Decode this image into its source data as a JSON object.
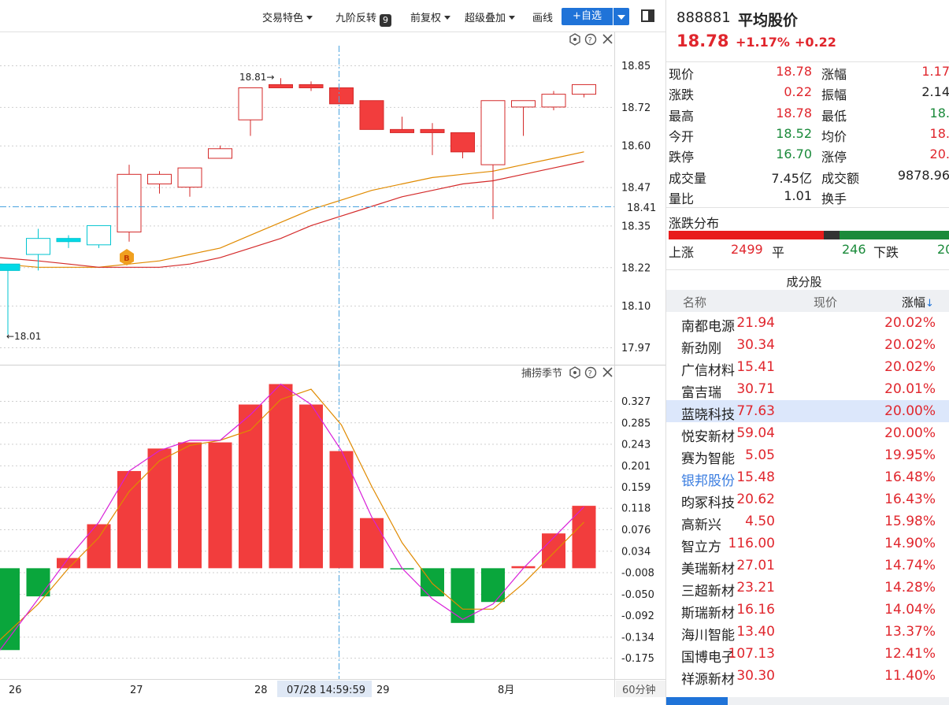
{
  "toolbar": {
    "trade_features": "交易特色",
    "nine_reversal": "九阶反转",
    "nine_badge": "9",
    "adjust": "前复权",
    "overlay": "超级叠加",
    "draw": "画线",
    "add_fav": "+自选"
  },
  "colors": {
    "up": "#e0262d",
    "down": "#1a8a3a",
    "accent": "#1f73d8",
    "up_candle": "#f23d3d",
    "down_candle_cyan": "#00d9e6",
    "macd_down": "#0aa63c"
  },
  "main_chart": {
    "y_ticks": [
      "18.85",
      "18.72",
      "18.60",
      "18.47",
      "18.35",
      "18.22",
      "18.10",
      "17.97"
    ],
    "crosshair_price": "18.41",
    "high_label": "18.81→",
    "low_label": "←18.01",
    "buy_marker": "B"
  },
  "sub_chart": {
    "indicator_name": "捕捞季节",
    "y_ticks": [
      "0.327",
      "0.285",
      "0.243",
      "0.201",
      "0.159",
      "0.118",
      "0.076",
      "0.034",
      "-0.008",
      "-0.050",
      "-0.092",
      "-0.134",
      "-0.175"
    ]
  },
  "x_axis": {
    "labels": [
      "26",
      "27",
      "28",
      "29",
      "8月"
    ],
    "crosshair_time": "07/28 14:59:59",
    "period": "60分钟"
  },
  "chart_data": [
    {
      "type": "candlestick",
      "title": "",
      "x": [
        "7/26-1",
        "7/26-2",
        "7/26-3",
        "7/26-4",
        "7/27-1",
        "7/27-2",
        "7/27-3",
        "7/27-4",
        "7/28-1",
        "7/28-2",
        "7/28-3",
        "7/28-4",
        "7/29-1",
        "7/29-2",
        "7/29-3",
        "7/29-4",
        "8/1-1",
        "8/1-2",
        "8/1-3",
        "8/1-4"
      ],
      "candles": [
        {
          "open": 18.23,
          "close": 18.21,
          "high": 18.23,
          "low": 18.01,
          "dir": "down"
        },
        {
          "open": 18.26,
          "close": 18.31,
          "high": 18.34,
          "low": 18.21,
          "dir": "down"
        },
        {
          "open": 18.31,
          "close": 18.3,
          "high": 18.32,
          "low": 18.28,
          "dir": "down"
        },
        {
          "open": 18.29,
          "close": 18.35,
          "high": 18.35,
          "low": 18.28,
          "dir": "down"
        },
        {
          "open": 18.33,
          "close": 18.51,
          "high": 18.54,
          "low": 18.3,
          "dir": "up"
        },
        {
          "open": 18.48,
          "close": 18.51,
          "high": 18.52,
          "low": 18.45,
          "dir": "up"
        },
        {
          "open": 18.47,
          "close": 18.53,
          "high": 18.53,
          "low": 18.44,
          "dir": "up"
        },
        {
          "open": 18.56,
          "close": 18.59,
          "high": 18.6,
          "low": 18.56,
          "dir": "up"
        },
        {
          "open": 18.68,
          "close": 18.78,
          "high": 18.78,
          "low": 18.63,
          "dir": "up"
        },
        {
          "open": 18.78,
          "close": 18.79,
          "high": 18.81,
          "low": 18.78,
          "dir": "up"
        },
        {
          "open": 18.78,
          "close": 18.79,
          "high": 18.8,
          "low": 18.77,
          "dir": "up"
        },
        {
          "open": 18.78,
          "close": 18.73,
          "high": 18.78,
          "low": 18.73,
          "dir": "up"
        },
        {
          "open": 18.74,
          "close": 18.65,
          "high": 18.74,
          "low": 18.65,
          "dir": "up"
        },
        {
          "open": 18.65,
          "close": 18.64,
          "high": 18.69,
          "low": 18.64,
          "dir": "up"
        },
        {
          "open": 18.65,
          "close": 18.64,
          "high": 18.67,
          "low": 18.57,
          "dir": "up"
        },
        {
          "open": 18.64,
          "close": 18.58,
          "high": 18.64,
          "low": 18.56,
          "dir": "up"
        },
        {
          "open": 18.54,
          "close": 18.74,
          "high": 18.74,
          "low": 18.37,
          "dir": "up"
        },
        {
          "open": 18.72,
          "close": 18.74,
          "high": 18.74,
          "low": 18.63,
          "dir": "up"
        },
        {
          "open": 18.72,
          "close": 18.76,
          "high": 18.77,
          "low": 18.71,
          "dir": "up"
        },
        {
          "open": 18.76,
          "close": 18.79,
          "high": 18.79,
          "low": 18.75,
          "dir": "up"
        }
      ],
      "ma_orange": [
        18.23,
        18.22,
        18.22,
        18.22,
        18.23,
        18.24,
        18.26,
        18.28,
        18.32,
        18.36,
        18.4,
        18.43,
        18.46,
        18.48,
        18.5,
        18.51,
        18.52,
        18.54,
        18.56,
        18.58
      ],
      "ma_red": [
        18.25,
        18.24,
        18.23,
        18.22,
        18.22,
        18.22,
        18.23,
        18.25,
        18.28,
        18.31,
        18.35,
        18.38,
        18.41,
        18.44,
        18.46,
        18.48,
        18.49,
        18.51,
        18.53,
        18.55
      ]
    },
    {
      "type": "bar",
      "title": "捕捞季节",
      "values": [
        -0.16,
        -0.055,
        0.02,
        0.086,
        0.19,
        0.234,
        0.246,
        0.246,
        0.32,
        0.36,
        0.32,
        0.229,
        0.098,
        -0.002,
        -0.055,
        -0.107,
        -0.066,
        0.004,
        0.068,
        0.122
      ],
      "line_magenta": [
        -0.16,
        -0.06,
        0.02,
        0.09,
        0.19,
        0.23,
        0.25,
        0.25,
        0.3,
        0.36,
        0.32,
        0.23,
        0.1,
        0.0,
        -0.06,
        -0.1,
        -0.07,
        0.0,
        0.06,
        0.12
      ],
      "line_orange": [
        -0.14,
        -0.07,
        0.0,
        0.06,
        0.15,
        0.21,
        0.24,
        0.25,
        0.27,
        0.33,
        0.35,
        0.28,
        0.16,
        0.05,
        -0.03,
        -0.08,
        -0.08,
        -0.03,
        0.03,
        0.09
      ]
    }
  ],
  "quote": {
    "code": "888881",
    "name": "平均股价",
    "price": "18.78",
    "pct": "+1.17%",
    "change": "+0.22",
    "stats": [
      {
        "l1": "现价",
        "v1": "18.78",
        "c1": "red",
        "l2": "涨幅",
        "v2": "1.17",
        "c2": "red"
      },
      {
        "l1": "涨跌",
        "v1": "0.22",
        "c1": "red",
        "l2": "振幅",
        "v2": "2.14",
        "c2": "blk"
      },
      {
        "l1": "最高",
        "v1": "18.78",
        "c1": "red",
        "l2": "最低",
        "v2": "18.",
        "c2": "green"
      },
      {
        "l1": "今开",
        "v1": "18.52",
        "c1": "green",
        "l2": "均价",
        "v2": "18.",
        "c2": "red"
      },
      {
        "l1": "跌停",
        "v1": "16.70",
        "c1": "green",
        "l2": "涨停",
        "v2": "20.",
        "c2": "red"
      },
      {
        "l1": "成交量",
        "v1": "7.45亿",
        "c1": "blk",
        "l2": "成交额",
        "v2": "9878.96",
        "c2": "blk"
      },
      {
        "l1": "量比",
        "v1": "1.01",
        "c1": "blk",
        "l2": "换手",
        "v2": "",
        "c2": "blk"
      }
    ],
    "distribution": {
      "title": "涨跌分布",
      "up_label": "上涨",
      "up": "2499",
      "flat_label": "平",
      "flat": "246",
      "down_label": "下跌",
      "down": "20"
    }
  },
  "constituents": {
    "title": "成分股",
    "col_name": "名称",
    "col_price": "现价",
    "col_pct": "涨幅",
    "sort_arrow": "↓",
    "rows": [
      {
        "name": "南都电源",
        "price": "21.94",
        "pct": "20.02%"
      },
      {
        "name": "新劲刚",
        "price": "30.34",
        "pct": "20.02%"
      },
      {
        "name": "广信材料",
        "price": "15.41",
        "pct": "20.02%"
      },
      {
        "name": "富吉瑞",
        "price": "30.71",
        "pct": "20.01%"
      },
      {
        "name": "蓝晓科技",
        "price": "77.63",
        "pct": "20.00%"
      },
      {
        "name": "悦安新材",
        "price": "59.04",
        "pct": "20.00%"
      },
      {
        "name": "赛为智能",
        "price": "5.05",
        "pct": "19.95%"
      },
      {
        "name": "银邦股份",
        "price": "15.48",
        "pct": "16.48%"
      },
      {
        "name": "昀冢科技",
        "price": "20.62",
        "pct": "16.43%"
      },
      {
        "name": "高新兴",
        "price": "4.50",
        "pct": "15.98%"
      },
      {
        "name": "智立方",
        "price": "116.00",
        "pct": "14.90%"
      },
      {
        "name": "美瑞新材",
        "price": "27.01",
        "pct": "14.74%"
      },
      {
        "name": "三超新材",
        "price": "23.21",
        "pct": "14.28%"
      },
      {
        "name": "斯瑞新材",
        "price": "16.16",
        "pct": "14.04%"
      },
      {
        "name": "海川智能",
        "price": "13.40",
        "pct": "13.37%"
      },
      {
        "name": "国博电子",
        "price": "107.13",
        "pct": "12.41%"
      },
      {
        "name": "祥源新材",
        "price": "30.30",
        "pct": "11.40%"
      }
    ]
  }
}
